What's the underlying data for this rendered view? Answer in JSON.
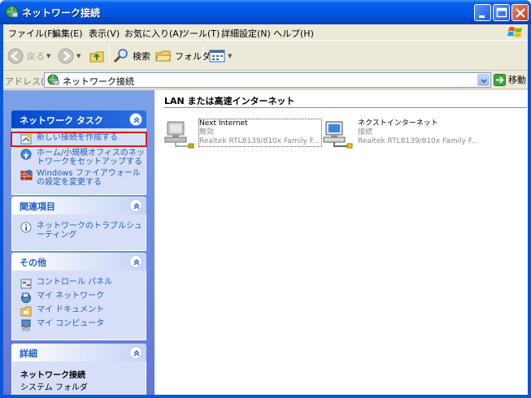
{
  "window": {
    "title": "ネットワーク接続",
    "minimize_label": "",
    "maximize_label": "",
    "close_label": ""
  },
  "menubar": {
    "items": [
      "ファイル(F)",
      "編集(E)",
      "表示(V)",
      "お気に入り(A)",
      "ツール(T)",
      "詳細設定(N)",
      "ヘルプ(H)"
    ]
  },
  "toolbar": {
    "back_label": "戻る",
    "search_label": "検索",
    "folders_label": "フォルダ"
  },
  "address": {
    "label": "アドレス(D)",
    "value": "ネットワーク接続",
    "go_label": "移動"
  },
  "taskpane": {
    "network_tasks": {
      "title": "ネットワーク タスク",
      "items": [
        {
          "label": "新しい接続を作成する",
          "icon": "new-connection-icon"
        },
        {
          "label": "ホーム/小規模オフィスのネットワークをセットアップする",
          "icon": "home-network-icon"
        },
        {
          "label": "Windows ファイアウォールの設定を変更する",
          "icon": "firewall-icon"
        }
      ]
    },
    "related": {
      "title": "関連項目",
      "items": [
        {
          "label": "ネットワークのトラブルシューティング",
          "icon": "info-icon"
        }
      ]
    },
    "other": {
      "title": "その他",
      "items": [
        {
          "label": "コントロール パネル",
          "icon": "control-panel-icon"
        },
        {
          "label": "マイ ネットワーク",
          "icon": "network-places-icon"
        },
        {
          "label": "マイ ドキュメント",
          "icon": "my-documents-icon"
        },
        {
          "label": "マイ コンピュータ",
          "icon": "my-computer-icon"
        }
      ]
    },
    "details": {
      "title": "詳細",
      "name": "ネットワーク接続",
      "type": "システム フォルダ"
    }
  },
  "content": {
    "group_title": "LAN または高速インターネット",
    "connections": [
      {
        "name": "Next Internet",
        "status": "無効",
        "device": "Realtek RTL8139/810x Family F..."
      },
      {
        "name": "ネクストインターネット",
        "status": "接続",
        "device": "Realtek RTL8139/810x Family F..."
      }
    ]
  },
  "colors": {
    "titlebar": "#0058e6",
    "taskpane_top": "#7ba2e7",
    "taskpane_bottom": "#6375d6",
    "link": "#215dc6",
    "highlight_box": "#e0161a"
  }
}
